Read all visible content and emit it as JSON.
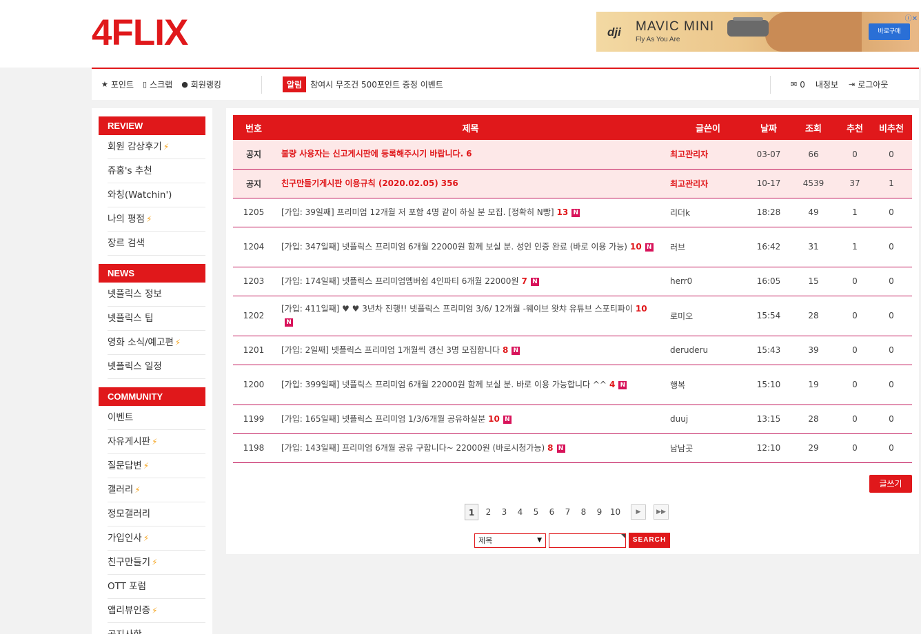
{
  "site": {
    "logo": "4FLIX"
  },
  "ad": {
    "brand": "dji",
    "title": "MAVIC MINI",
    "tagline": "Fly As You Are",
    "button": "바로구매",
    "info": "ⓘ✕"
  },
  "nav": {
    "left": [
      {
        "icon": "star-icon",
        "glyph": "★",
        "label": "포인트"
      },
      {
        "icon": "bookmark-icon",
        "glyph": "▯",
        "label": "스크랩"
      },
      {
        "icon": "user-icon",
        "glyph": "●",
        "label": "회원랭킹"
      }
    ],
    "notice_badge": "알림",
    "notice_text": "참여시 무조건 500포인트 증정 이벤트",
    "mail_count": "0",
    "myinfo": "내정보",
    "logout": "로그아웃"
  },
  "sidebar": {
    "sections": [
      {
        "title": "REVIEW",
        "items": [
          {
            "label": "회원 감상후기",
            "hot": true
          },
          {
            "label": "쥬홍's 추천",
            "hot": false
          },
          {
            "label": "와칭(Watchin')",
            "hot": false
          },
          {
            "label": "나의 평점",
            "hot": true
          },
          {
            "label": "장르 검색",
            "hot": false
          }
        ]
      },
      {
        "title": "NEWS",
        "items": [
          {
            "label": "넷플릭스 정보",
            "hot": false
          },
          {
            "label": "넷플릭스 팁",
            "hot": false
          },
          {
            "label": "영화 소식/예고편",
            "hot": true
          },
          {
            "label": "넷플릭스 일정",
            "hot": false
          }
        ]
      },
      {
        "title": "COMMUNITY",
        "items": [
          {
            "label": "이벤트",
            "hot": false
          },
          {
            "label": "자유게시판",
            "hot": true
          },
          {
            "label": "질문답변",
            "hot": true
          },
          {
            "label": "갤러리",
            "hot": true
          },
          {
            "label": "정모갤러리",
            "hot": false
          },
          {
            "label": "가입인사",
            "hot": true
          },
          {
            "label": "친구만들기",
            "hot": true
          },
          {
            "label": "OTT 포럼",
            "hot": false
          },
          {
            "label": "앱리뷰인증",
            "hot": true
          },
          {
            "label": "공지사항",
            "hot": false
          }
        ]
      }
    ]
  },
  "board": {
    "headers": [
      "번호",
      "제목",
      "글쓴이",
      "날짜",
      "조회",
      "추천",
      "비추천"
    ],
    "rows": [
      {
        "num": "공지",
        "title": "불량 사용자는 신고게시판에 등록해주시기 바랍니다.",
        "comments": "6",
        "new": false,
        "author": "최고관리자",
        "date": "03-07",
        "views": "66",
        "up": "0",
        "down": "0",
        "notice": true
      },
      {
        "num": "공지",
        "title": "친구만들기게시판 이용규칙 (2020.02.05)",
        "comments": "356",
        "new": false,
        "author": "최고관리자",
        "date": "10-17",
        "views": "4539",
        "up": "37",
        "down": "1",
        "notice": true
      },
      {
        "num": "1205",
        "title": "[가입: 39일째] 프리미엄 12개월 저 포함 4명 같이 하실 분 모집. [정확히 N빵]",
        "comments": "13",
        "new": true,
        "author": "리더k",
        "date": "18:28",
        "views": "49",
        "up": "1",
        "down": "0",
        "notice": false
      },
      {
        "num": "1204",
        "title": "[가입: 347일째] 넷플릭스 프리미엄 6개월 22000원 함께 보실 분. 성인 인증 완료 (바로 이용 가능)",
        "comments": "10",
        "new": true,
        "author": "러브",
        "date": "16:42",
        "views": "31",
        "up": "1",
        "down": "0",
        "notice": false
      },
      {
        "num": "1203",
        "title": "[가입: 174일째] 넷플릭스 프리미엄멤버쉽 4인파티 6개월 22000원",
        "comments": "7",
        "new": true,
        "author": "herr0",
        "date": "16:05",
        "views": "15",
        "up": "0",
        "down": "0",
        "notice": false
      },
      {
        "num": "1202",
        "title": "[가입: 411일째] ♥ ♥ 3년차 진행!! 넷플릭스 프리미엄 3/6/ 12개월 -웨이브 왓챠 유튜브 스포티파이",
        "comments": "10",
        "new": true,
        "author": "로미오",
        "date": "15:54",
        "views": "28",
        "up": "0",
        "down": "0",
        "notice": false
      },
      {
        "num": "1201",
        "title": "[가입: 2일째] 넷플릭스 프리미엄 1개월씩 갱신 3명 모집합니다",
        "comments": "8",
        "new": true,
        "author": "deruderu",
        "date": "15:43",
        "views": "39",
        "up": "0",
        "down": "0",
        "notice": false
      },
      {
        "num": "1200",
        "title": "[가입: 399일째] 넷플릭스 프리미엄 6개월 22000원 함께 보실 분. 바로 이용 가능합니다 ^^",
        "comments": "4",
        "new": true,
        "author": "행복",
        "date": "15:10",
        "views": "19",
        "up": "0",
        "down": "0",
        "notice": false
      },
      {
        "num": "1199",
        "title": "[가입: 165일째] 넷플릭스 프리미엄 1/3/6개월 공유하실분",
        "comments": "10",
        "new": true,
        "author": "duuj",
        "date": "13:15",
        "views": "28",
        "up": "0",
        "down": "0",
        "notice": false
      },
      {
        "num": "1198",
        "title": "[가입: 143일째] 프리미엄 6개월 공유 구합니다~ 22000원 (바로시청가능)",
        "comments": "8",
        "new": true,
        "author": "남남곳",
        "date": "12:10",
        "views": "29",
        "up": "0",
        "down": "0",
        "notice": false
      }
    ],
    "new_badge": "N",
    "write_button": "글쓰기"
  },
  "pager": {
    "pages": [
      "1",
      "2",
      "3",
      "4",
      "5",
      "6",
      "7",
      "8",
      "9",
      "10"
    ],
    "current": "1",
    "next": "▶",
    "last": "▶▶"
  },
  "search": {
    "field": "제목",
    "caret": "▼",
    "value": "",
    "button": "SEARCH"
  },
  "colors": {
    "accent": "#e0181b",
    "row_border": "#c2185b",
    "notice_bg": "#fde8e8",
    "new_badge": "#d8135a"
  }
}
